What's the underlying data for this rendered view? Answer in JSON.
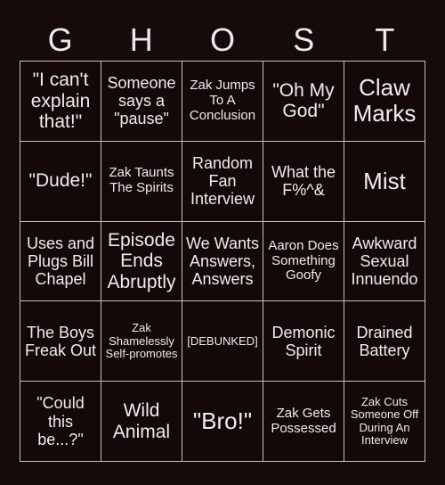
{
  "card": {
    "title_letters": [
      "G",
      "H",
      "O",
      "S",
      "T"
    ],
    "background_color": "#170a0a",
    "cell_background_color": "#140808",
    "grid_line_color": "#c9bebe",
    "text_color": "#f2ecec",
    "columns": 5,
    "rows": 5,
    "cells": [
      {
        "text": "\"I can't explain that!\"",
        "size": "lg"
      },
      {
        "text": "Someone says a \"pause\"",
        "size": "md"
      },
      {
        "text": "Zak Jumps To A Conclusion",
        "size": "sm"
      },
      {
        "text": "\"Oh My God\"",
        "size": "lg"
      },
      {
        "text": "Claw Marks",
        "size": "xl"
      },
      {
        "text": "\"Dude!\"",
        "size": "lg"
      },
      {
        "text": "Zak Taunts The Spirits",
        "size": "sm"
      },
      {
        "text": "Random Fan Interview",
        "size": "md"
      },
      {
        "text": "What the F%^&",
        "size": "md"
      },
      {
        "text": "Mist",
        "size": "xl"
      },
      {
        "text": "Uses and Plugs Bill Chapel",
        "size": "md"
      },
      {
        "text": "Episode Ends Abruptly",
        "size": "lg"
      },
      {
        "text": "We Wants Answers, Answers",
        "size": "md"
      },
      {
        "text": "Aaron Does Something Goofy",
        "size": "sm"
      },
      {
        "text": "Awkward Sexual Innuendo",
        "size": "md"
      },
      {
        "text": "The Boys Freak Out",
        "size": "md"
      },
      {
        "text": "Zak Shamelessly Self-promotes",
        "size": "xs"
      },
      {
        "text": "[DEBUNKED]",
        "size": "xs"
      },
      {
        "text": "Demonic Spirit",
        "size": "md"
      },
      {
        "text": "Drained Battery",
        "size": "md"
      },
      {
        "text": "\"Could this be...?\"",
        "size": "md"
      },
      {
        "text": "Wild Animal",
        "size": "lg"
      },
      {
        "text": "\"Bro!\"",
        "size": "xl"
      },
      {
        "text": "Zak Gets Possessed",
        "size": "sm"
      },
      {
        "text": "Zak Cuts Someone Off During An Interview",
        "size": "xs"
      }
    ]
  }
}
